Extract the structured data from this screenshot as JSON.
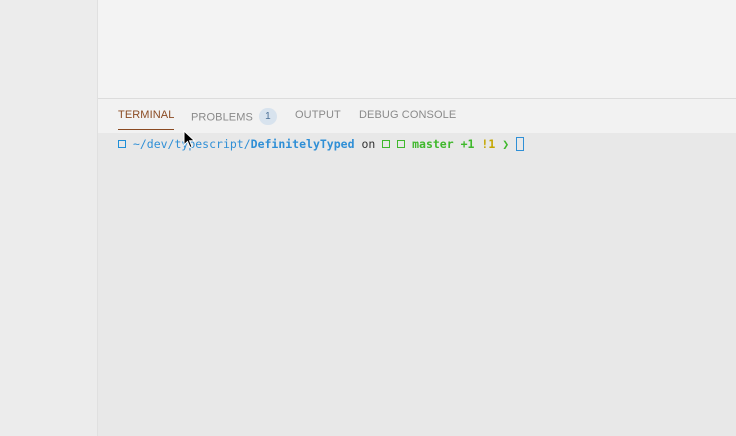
{
  "panel": {
    "tabs": [
      {
        "label": "TERMINAL",
        "active": true
      },
      {
        "label": "PROBLEMS",
        "active": false,
        "badge": "1"
      },
      {
        "label": "OUTPUT",
        "active": false
      },
      {
        "label": "DEBUG CONSOLE",
        "active": false
      }
    ]
  },
  "terminal": {
    "path_prefix": "~/dev/typescript/",
    "path_current": "DefinitelyTyped",
    "on_text": "on",
    "branch": "master",
    "staged": "+1",
    "modified": "!1",
    "prompt_symbol": "❯"
  },
  "colors": {
    "accent_active_tab": "#8a4a22",
    "path_blue": "#2f8fd6",
    "branch_green": "#3fb82c",
    "status_yellow": "#c4a600"
  }
}
